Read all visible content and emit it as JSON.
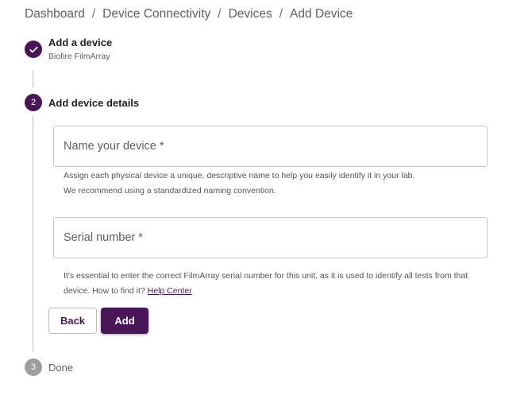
{
  "breadcrumb": {
    "items": [
      "Dashboard",
      "Device Connectivity",
      "Devices"
    ],
    "current": "Add Device",
    "separator": "/"
  },
  "steps": [
    {
      "title": "Add a device",
      "subtitle": "Biofire FilmArray",
      "state": "completed",
      "icon": "check-icon"
    },
    {
      "number": "2",
      "title": "Add device details",
      "state": "active"
    },
    {
      "number": "3",
      "title": "Done",
      "state": "pending"
    }
  ],
  "form": {
    "name_placeholder": "Name your device *",
    "name_helper_line1": "Assign each physical device a unique, descriptive name to help you easily identify it in your lab.",
    "name_helper_line2": "We recommend using a standardized naming convention.",
    "serial_placeholder": "Serial number *",
    "serial_helper": "It's essential to enter the correct FilmArray serial number for this unit, as it is used to identify all tests from that device. How to find it?",
    "help_link": "Help Center"
  },
  "buttons": {
    "back": "Back",
    "add": "Add"
  },
  "colors": {
    "accent": "#4a1558",
    "pending": "#9e9e9e"
  }
}
